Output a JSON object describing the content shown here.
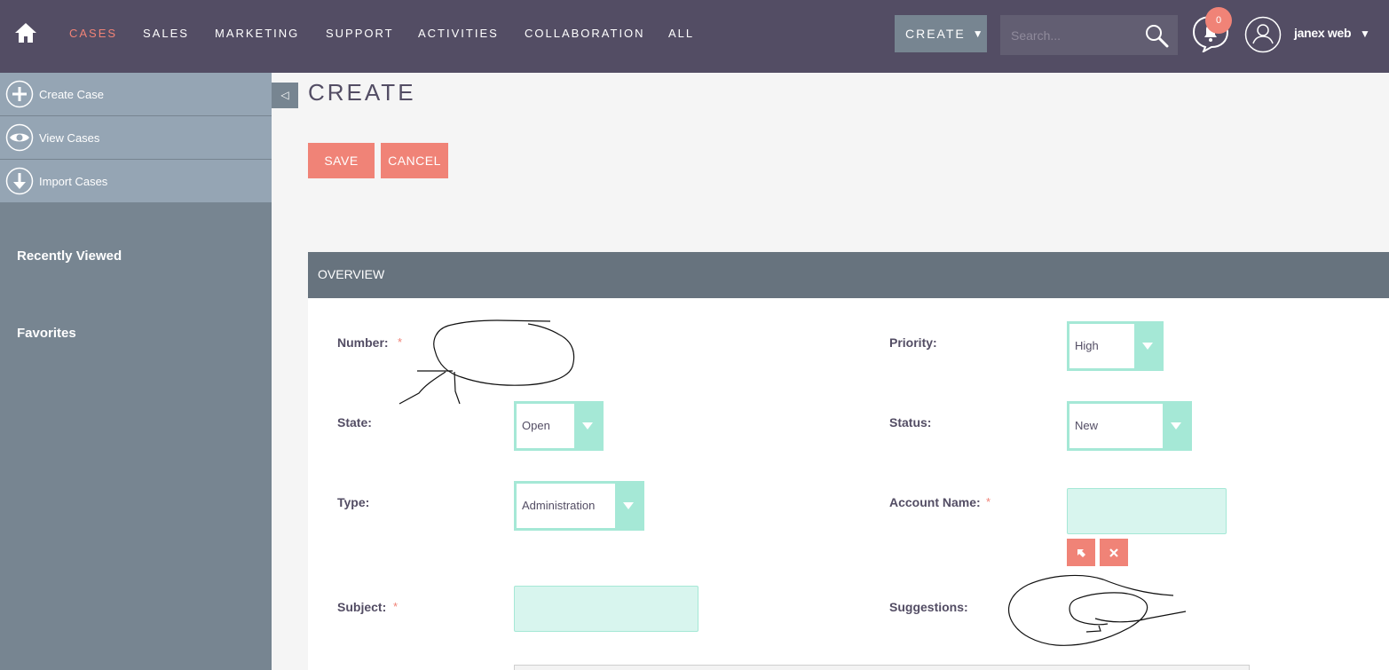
{
  "nav": {
    "items": [
      "CASES",
      "SALES",
      "MARKETING",
      "SUPPORT",
      "ACTIVITIES",
      "COLLABORATION",
      "ALL"
    ],
    "create_label": "CREATE",
    "search_placeholder": "Search...",
    "notification_count": "0",
    "username": "janex web"
  },
  "sidebar": {
    "actions": [
      {
        "label": "Create Case",
        "icon": "plus-circle-icon"
      },
      {
        "label": "View Cases",
        "icon": "eye-icon"
      },
      {
        "label": "Import Cases",
        "icon": "download-arrow-icon"
      }
    ],
    "recently_viewed": "Recently Viewed",
    "favorites": "Favorites"
  },
  "page": {
    "title": "CREATE",
    "save_label": "SAVE",
    "cancel_label": "CANCEL"
  },
  "panel": {
    "title": "OVERVIEW",
    "fields": {
      "number_label": "Number:",
      "priority_label": "Priority:",
      "priority_value": "High",
      "state_label": "State:",
      "state_value": "Open",
      "status_label": "Status:",
      "status_value": "New",
      "type_label": "Type:",
      "type_value": "Administration",
      "account_label": "Account Name:",
      "subject_label": "Subject:",
      "suggestions_label": "Suggestions:",
      "required_marker": "*"
    }
  },
  "colors": {
    "topbar": "#534d64",
    "accent": "#f08377",
    "sidebar": "#778591",
    "field_border": "#a5e8d6",
    "panel_header": "#67737e"
  }
}
